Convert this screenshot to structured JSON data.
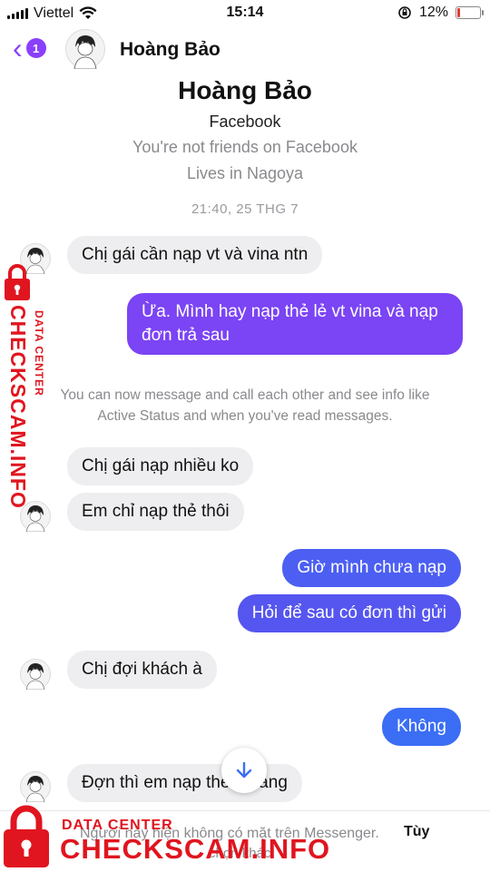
{
  "status_bar": {
    "carrier": "Viettel",
    "time": "15:14",
    "battery": "12%",
    "battery_level": 0.12
  },
  "header": {
    "back_count": "1",
    "contact_name": "Hoàng Bảo"
  },
  "profile": {
    "name": "Hoàng Bảo",
    "platform": "Facebook",
    "friend_status": "You're not friends on Facebook",
    "location": "Lives in Nagoya"
  },
  "timestamp": "21:40, 25 THG 7",
  "messages": [
    {
      "from": "them",
      "text": "Chị gái cần nạp vt và vina ntn"
    },
    {
      "from": "me",
      "text": "Ừa. Mình hay nạp thẻ lẻ vt vina và nạp đơn trả sau"
    },
    {
      "from": "them",
      "text": "Chị gái nạp nhiều ko"
    },
    {
      "from": "them",
      "text": "Em chỉ nạp thẻ thôi"
    },
    {
      "from": "me",
      "text": "Giờ mình chưa nạp"
    },
    {
      "from": "me",
      "text": "Hỏi để sau có đơn thì gửi"
    },
    {
      "from": "them",
      "text": "Chị đợi khách à"
    },
    {
      "from": "me",
      "text": "Không"
    },
    {
      "from": "them",
      "text": "Đợn thì em nạp theo tháng"
    }
  ],
  "system_message": {
    "line1": "You can now message and call each other and see info like",
    "line2": "Active Status and when you've read messages."
  },
  "bottom_notice": {
    "text": "Người này hiện không có mặt trên Messenger.",
    "link": "Tùy",
    "line2": "chọn khác"
  },
  "watermark": {
    "label_small": "DATA CENTER",
    "label_big": "CHECKSCAM.INFO"
  },
  "colors": {
    "accent": "#8a3ffc",
    "bubble_in": "#eeeef0",
    "watermark": "#e0151f"
  }
}
